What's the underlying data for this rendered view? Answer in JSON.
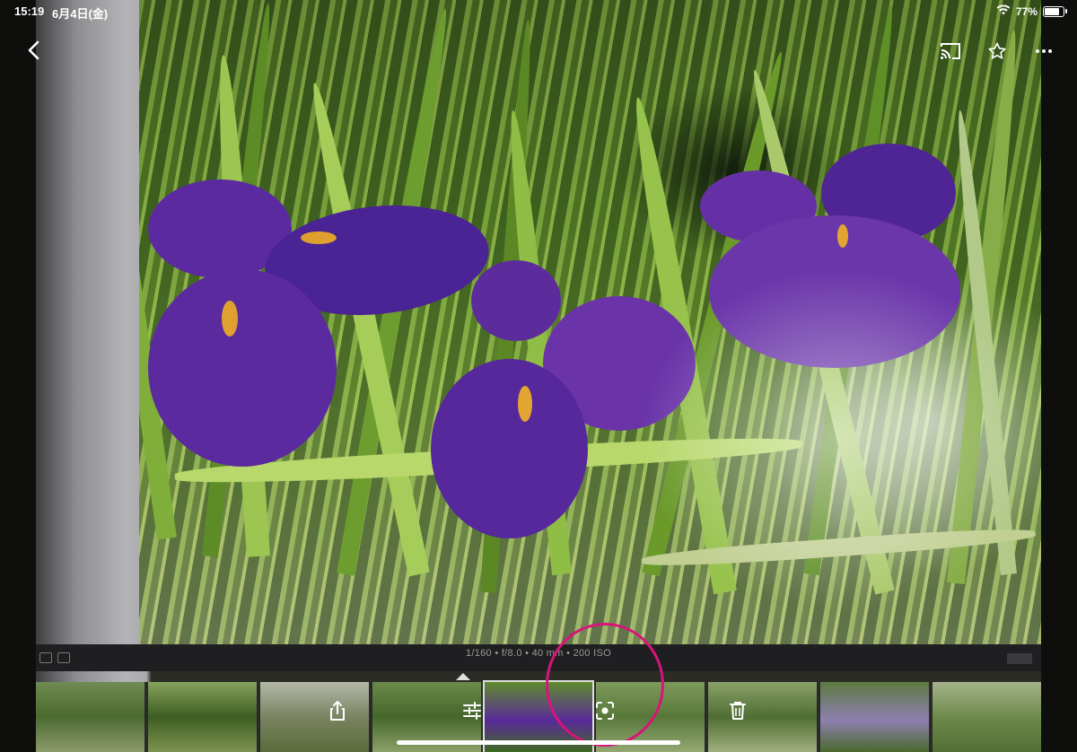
{
  "status_bar": {
    "time": "15:19",
    "date": "6月4日(金)",
    "battery": "77%",
    "battery_level": 0.77
  },
  "top_bar": {
    "back_icon": "chevron-left-icon",
    "cast_icon": "cast-icon",
    "star_icon": "star-icon",
    "more_icon": "more-horizontal-icon"
  },
  "photo": {
    "exif_line": "1/160 • f/8.0 • 40 mm • 200 ISO"
  },
  "toolbar": {
    "share_icon": "share-icon",
    "edit_icon": "sliders-icon",
    "lens_icon": "google-lens-icon",
    "delete_icon": "trash-icon"
  },
  "colors": {
    "highlight": "#d8147a",
    "iris_purple": "#5a2a9a"
  }
}
